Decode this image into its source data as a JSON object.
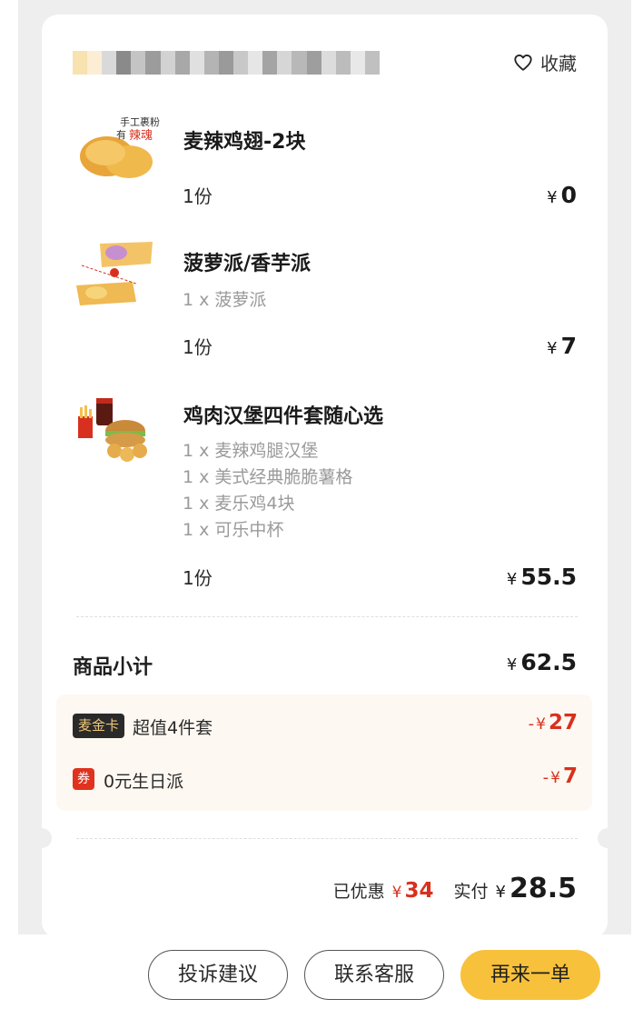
{
  "header": {
    "favorite_label": "收藏",
    "store_name_obscured": true
  },
  "items": [
    {
      "name": "麦辣鸡翅-2块",
      "thumb_text": "手工裹粉 有辣魂",
      "options": [],
      "qty": "1份",
      "currency": "¥",
      "price": "0"
    },
    {
      "name": "菠萝派/香芋派",
      "options": [
        "1 x 菠萝派"
      ],
      "qty": "1份",
      "currency": "¥",
      "price": "7"
    },
    {
      "name": "鸡肉汉堡四件套随心选",
      "options": [
        "1 x 麦辣鸡腿汉堡",
        "1 x 美式经典脆脆薯格",
        "1 x 麦乐鸡4块",
        "1 x 可乐中杯"
      ],
      "qty": "1份",
      "currency": "¥",
      "price": "55.5"
    }
  ],
  "summary": {
    "subtotal_label": "商品小计",
    "subtotal_currency": "¥",
    "subtotal": "62.5",
    "discounts": [
      {
        "badge": "麦金卡",
        "label": "超值4件套",
        "minus": "-",
        "currency": "¥",
        "amount": "27"
      },
      {
        "badge": "券",
        "label": "0元生日派",
        "minus": "-",
        "currency": "¥",
        "amount": "7"
      }
    ],
    "saved_label": "已优惠",
    "saved_currency": "¥",
    "saved": "34",
    "paid_label": "实付",
    "paid_currency": "¥",
    "paid": "28.5"
  },
  "actions": {
    "complaint": "投诉建议",
    "contact": "联系客服",
    "reorder": "再来一单"
  },
  "colors": {
    "accent_yellow": "#f7c13b",
    "discount_red": "#d8301e",
    "discount_bg": "#fdf8f1",
    "page_bg": "#eeeeee"
  }
}
